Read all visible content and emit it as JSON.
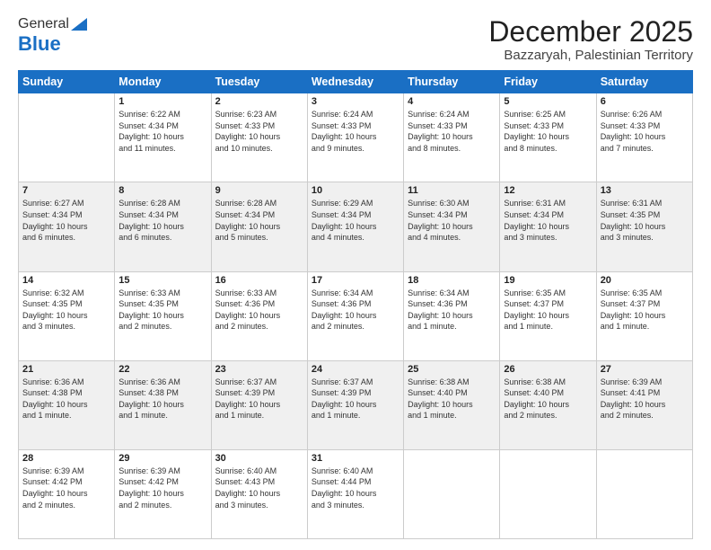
{
  "logo": {
    "general": "General",
    "blue": "Blue"
  },
  "header": {
    "month": "December 2025",
    "location": "Bazzaryah, Palestinian Territory"
  },
  "weekdays": [
    "Sunday",
    "Monday",
    "Tuesday",
    "Wednesday",
    "Thursday",
    "Friday",
    "Saturday"
  ],
  "weeks": [
    [
      {
        "day": "",
        "info": ""
      },
      {
        "day": "1",
        "info": "Sunrise: 6:22 AM\nSunset: 4:34 PM\nDaylight: 10 hours\nand 11 minutes."
      },
      {
        "day": "2",
        "info": "Sunrise: 6:23 AM\nSunset: 4:33 PM\nDaylight: 10 hours\nand 10 minutes."
      },
      {
        "day": "3",
        "info": "Sunrise: 6:24 AM\nSunset: 4:33 PM\nDaylight: 10 hours\nand 9 minutes."
      },
      {
        "day": "4",
        "info": "Sunrise: 6:24 AM\nSunset: 4:33 PM\nDaylight: 10 hours\nand 8 minutes."
      },
      {
        "day": "5",
        "info": "Sunrise: 6:25 AM\nSunset: 4:33 PM\nDaylight: 10 hours\nand 8 minutes."
      },
      {
        "day": "6",
        "info": "Sunrise: 6:26 AM\nSunset: 4:33 PM\nDaylight: 10 hours\nand 7 minutes."
      }
    ],
    [
      {
        "day": "7",
        "info": "Sunrise: 6:27 AM\nSunset: 4:34 PM\nDaylight: 10 hours\nand 6 minutes."
      },
      {
        "day": "8",
        "info": "Sunrise: 6:28 AM\nSunset: 4:34 PM\nDaylight: 10 hours\nand 6 minutes."
      },
      {
        "day": "9",
        "info": "Sunrise: 6:28 AM\nSunset: 4:34 PM\nDaylight: 10 hours\nand 5 minutes."
      },
      {
        "day": "10",
        "info": "Sunrise: 6:29 AM\nSunset: 4:34 PM\nDaylight: 10 hours\nand 4 minutes."
      },
      {
        "day": "11",
        "info": "Sunrise: 6:30 AM\nSunset: 4:34 PM\nDaylight: 10 hours\nand 4 minutes."
      },
      {
        "day": "12",
        "info": "Sunrise: 6:31 AM\nSunset: 4:34 PM\nDaylight: 10 hours\nand 3 minutes."
      },
      {
        "day": "13",
        "info": "Sunrise: 6:31 AM\nSunset: 4:35 PM\nDaylight: 10 hours\nand 3 minutes."
      }
    ],
    [
      {
        "day": "14",
        "info": "Sunrise: 6:32 AM\nSunset: 4:35 PM\nDaylight: 10 hours\nand 3 minutes."
      },
      {
        "day": "15",
        "info": "Sunrise: 6:33 AM\nSunset: 4:35 PM\nDaylight: 10 hours\nand 2 minutes."
      },
      {
        "day": "16",
        "info": "Sunrise: 6:33 AM\nSunset: 4:36 PM\nDaylight: 10 hours\nand 2 minutes."
      },
      {
        "day": "17",
        "info": "Sunrise: 6:34 AM\nSunset: 4:36 PM\nDaylight: 10 hours\nand 2 minutes."
      },
      {
        "day": "18",
        "info": "Sunrise: 6:34 AM\nSunset: 4:36 PM\nDaylight: 10 hours\nand 1 minute."
      },
      {
        "day": "19",
        "info": "Sunrise: 6:35 AM\nSunset: 4:37 PM\nDaylight: 10 hours\nand 1 minute."
      },
      {
        "day": "20",
        "info": "Sunrise: 6:35 AM\nSunset: 4:37 PM\nDaylight: 10 hours\nand 1 minute."
      }
    ],
    [
      {
        "day": "21",
        "info": "Sunrise: 6:36 AM\nSunset: 4:38 PM\nDaylight: 10 hours\nand 1 minute."
      },
      {
        "day": "22",
        "info": "Sunrise: 6:36 AM\nSunset: 4:38 PM\nDaylight: 10 hours\nand 1 minute."
      },
      {
        "day": "23",
        "info": "Sunrise: 6:37 AM\nSunset: 4:39 PM\nDaylight: 10 hours\nand 1 minute."
      },
      {
        "day": "24",
        "info": "Sunrise: 6:37 AM\nSunset: 4:39 PM\nDaylight: 10 hours\nand 1 minute."
      },
      {
        "day": "25",
        "info": "Sunrise: 6:38 AM\nSunset: 4:40 PM\nDaylight: 10 hours\nand 1 minute."
      },
      {
        "day": "26",
        "info": "Sunrise: 6:38 AM\nSunset: 4:40 PM\nDaylight: 10 hours\nand 2 minutes."
      },
      {
        "day": "27",
        "info": "Sunrise: 6:39 AM\nSunset: 4:41 PM\nDaylight: 10 hours\nand 2 minutes."
      }
    ],
    [
      {
        "day": "28",
        "info": "Sunrise: 6:39 AM\nSunset: 4:42 PM\nDaylight: 10 hours\nand 2 minutes."
      },
      {
        "day": "29",
        "info": "Sunrise: 6:39 AM\nSunset: 4:42 PM\nDaylight: 10 hours\nand 2 minutes."
      },
      {
        "day": "30",
        "info": "Sunrise: 6:40 AM\nSunset: 4:43 PM\nDaylight: 10 hours\nand 3 minutes."
      },
      {
        "day": "31",
        "info": "Sunrise: 6:40 AM\nSunset: 4:44 PM\nDaylight: 10 hours\nand 3 minutes."
      },
      {
        "day": "",
        "info": ""
      },
      {
        "day": "",
        "info": ""
      },
      {
        "day": "",
        "info": ""
      }
    ]
  ]
}
